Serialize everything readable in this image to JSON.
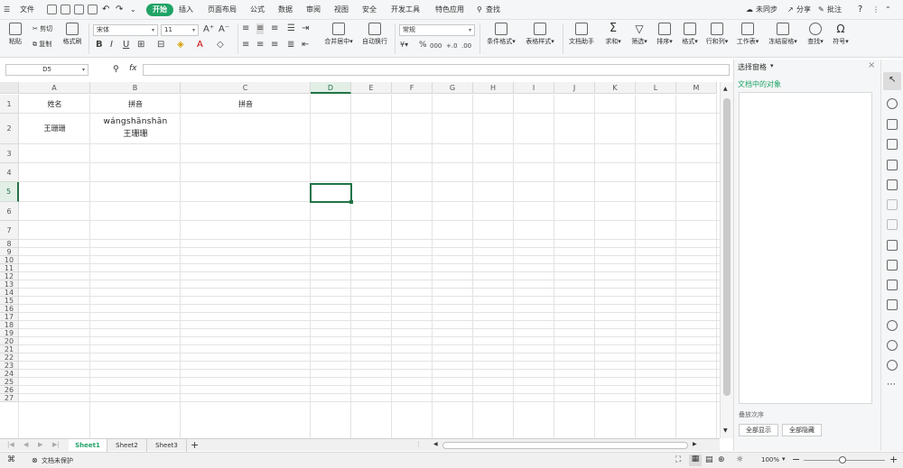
{
  "menubar": {
    "file": "文件",
    "tabs": [
      "开始",
      "插入",
      "页面布局",
      "公式",
      "数据",
      "审阅",
      "视图",
      "安全",
      "开发工具",
      "特色应用"
    ],
    "search": "查找",
    "sync": "未同步",
    "share": "分享",
    "comment": "批注",
    "help": "?"
  },
  "ribbon": {
    "paste": "粘贴",
    "cut": "剪切",
    "copy": "复制",
    "format_painter": "格式刷",
    "font_name": "宋体",
    "font_size": "11",
    "merge_center": "合并居中",
    "wrap_text": "自动换行",
    "number_format": "常规",
    "conditional_format": "条件格式",
    "table_style": "表格样式",
    "doc_helper": "文档助手",
    "sum": "求和",
    "filter": "筛选",
    "sort": "排序",
    "format": "格式",
    "row_col": "行和列",
    "worksheet": "工作表",
    "freeze": "冻结窗格",
    "find": "查找",
    "symbol": "符号",
    "bold": "B",
    "italic": "I",
    "underline": "U",
    "percent": "%",
    "thousands": "000",
    "dec_inc": "+.0",
    "dec_dec": ".00"
  },
  "formula_bar": {
    "name_box": "D5",
    "fx": "fx",
    "content": ""
  },
  "grid": {
    "columns": [
      "A",
      "B",
      "C",
      "D",
      "E",
      "F",
      "G",
      "H",
      "I",
      "J",
      "K",
      "L",
      "M"
    ],
    "rows": [
      "1",
      "2",
      "3",
      "4",
      "5",
      "6",
      "7",
      "8",
      "9",
      "10",
      "11",
      "12",
      "13",
      "14",
      "15",
      "16",
      "17",
      "18",
      "19",
      "20",
      "21",
      "22",
      "23",
      "24",
      "25",
      "26",
      "27"
    ],
    "a1": "姓名",
    "b1": "拼音",
    "c1": "拼音",
    "a2": "王珊珊",
    "b2_pinyin": "wángshānshān",
    "b2_text": "王珊珊"
  },
  "pane": {
    "title": "选择窗格",
    "subtitle": "文档中的对象",
    "show_all": "全部显示",
    "hide_all": "全部隐藏",
    "footer_label": "叠放次序"
  },
  "sheets": [
    "Sheet1",
    "Sheet2",
    "Sheet3"
  ],
  "add_sheet": "+",
  "status": {
    "protect": "文档未保护",
    "zoom": "100%"
  },
  "colors": {
    "accent": "#21a366",
    "selection": "#217346"
  }
}
